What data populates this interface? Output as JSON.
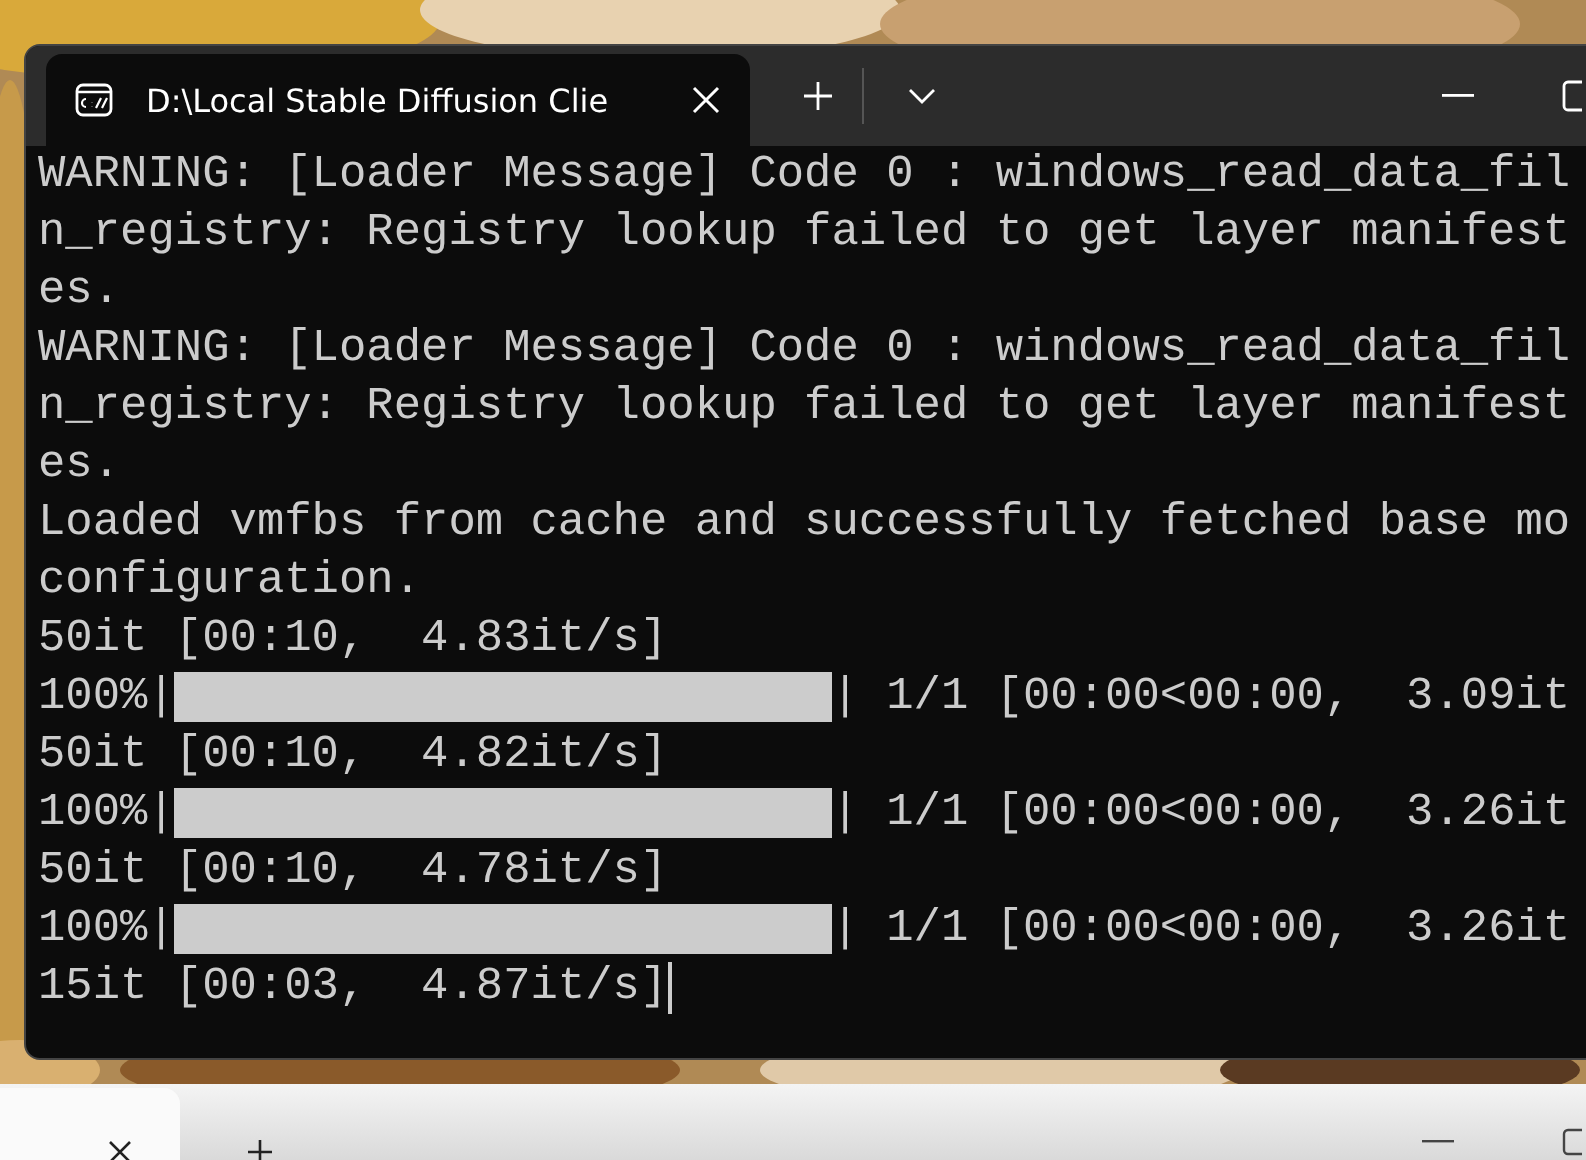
{
  "window": {
    "tabs": [
      {
        "title": "D:\\Local Stable Diffusion Clie",
        "selected": true
      }
    ]
  },
  "console": {
    "lines": [
      {
        "kind": "text",
        "text": "WARNING: [Loader Message] Code 0 : windows_read_data_fil"
      },
      {
        "kind": "text",
        "text": "n_registry: Registry lookup failed to get layer manifest"
      },
      {
        "kind": "text",
        "text": "es."
      },
      {
        "kind": "text",
        "text": "WARNING: [Loader Message] Code 0 : windows_read_data_fil"
      },
      {
        "kind": "text",
        "text": "n_registry: Registry lookup failed to get layer manifest"
      },
      {
        "kind": "text",
        "text": "es."
      },
      {
        "kind": "text",
        "text": "Loaded vmfbs from cache and successfully fetched base mo"
      },
      {
        "kind": "text",
        "text": "configuration."
      },
      {
        "kind": "text",
        "text": "50it [00:10,  4.83it/s]"
      },
      {
        "kind": "progress",
        "prefix": "100%|",
        "level": 1,
        "suffix": "| 1/1 [00:00<00:00,  3.09it"
      },
      {
        "kind": "text",
        "text": "50it [00:10,  4.82it/s]"
      },
      {
        "kind": "progress",
        "prefix": "100%|",
        "level": 1,
        "suffix": "| 1/1 [00:00<00:00,  3.26it"
      },
      {
        "kind": "text",
        "text": "50it [00:10,  4.78it/s]"
      },
      {
        "kind": "progress",
        "prefix": "100%|",
        "level": 1,
        "suffix": "| 1/1 [00:00<00:00,  3.26it"
      },
      {
        "kind": "text",
        "text": "15it [00:03,  4.87it/s]"
      }
    ],
    "cursor": true
  }
}
